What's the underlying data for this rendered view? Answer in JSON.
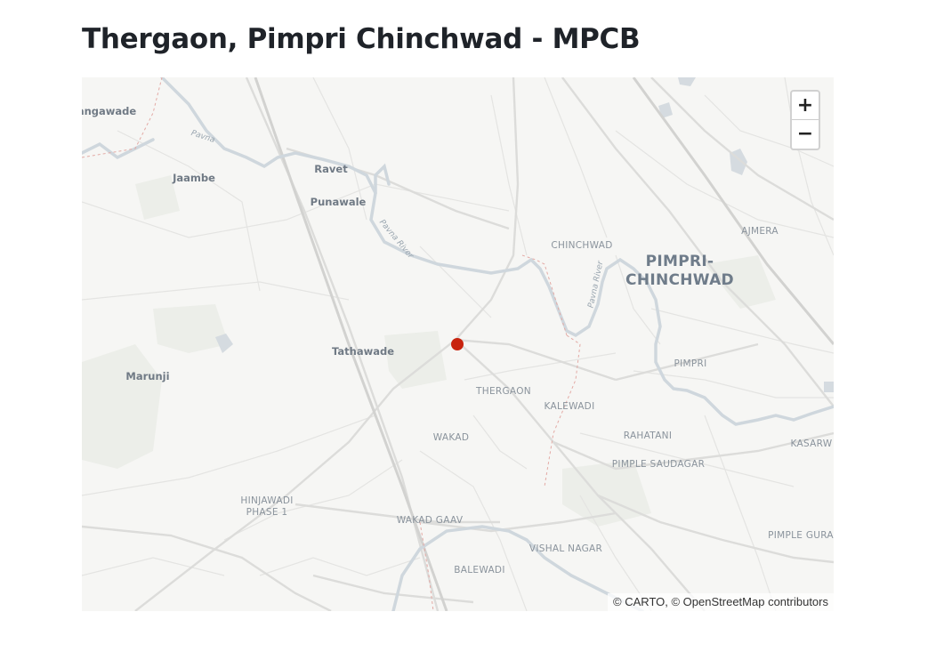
{
  "page": {
    "title": "Thergaon, Pimpri Chinchwad - MPCB"
  },
  "map": {
    "zoom_in_label": "+",
    "zoom_out_label": "−",
    "attribution": "© CARTO, © OpenStreetMap contributors",
    "marker_color": "#c8230e",
    "labels": {
      "gangawade": "angawade",
      "jaambe": "Jaambe",
      "ravet": "Ravet",
      "punawale": "Punawale",
      "chinchwad": "CHINCHWAD",
      "ajmera": "AJMERA",
      "pimpri_chinchwad_1": "PIMPRI-",
      "pimpri_chinchwad_2": "CHINCHWAD",
      "tathawade": "Tathawade",
      "marunji": "Marunji",
      "thergaon": "THERGAON",
      "pimpri": "PIMPRI",
      "kalewadi": "KALEWADI",
      "wakad": "WAKAD",
      "rahatani": "RAHATANI",
      "kasarwadi": "KASARW",
      "pimple_saudagar": "PIMPLE SAUDAGAR",
      "hinjawadi_1": "HINJAWADI",
      "hinjawadi_2": "PHASE 1",
      "wakad_gaav": "WAKAD GAAV",
      "pimple_gurav": "PIMPLE GURA",
      "vishal_nagar": "VISHAL NAGAR",
      "balewadi": "BALEWADI",
      "pavana_1": "Pavna",
      "pavana_river": "Pavna River",
      "pavana_river_2": "Pavna River"
    }
  }
}
